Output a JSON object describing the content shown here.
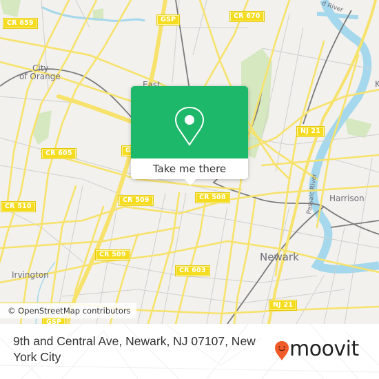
{
  "map": {
    "colors": {
      "background": "#f2f1ed",
      "major_road": "#f7e26b",
      "minor_road": "#c8c8c8",
      "water": "#a5d8ec",
      "park": "#d6e8c0",
      "rail": "#7a7a7a",
      "shield": "#f5dc1f"
    },
    "road_shields": [
      {
        "label": "CR 659"
      },
      {
        "label": "GSP"
      },
      {
        "label": "CR 670"
      },
      {
        "label": "CR 605"
      },
      {
        "label": "GSP"
      },
      {
        "label": "NJ 21"
      },
      {
        "label": "CR 510"
      },
      {
        "label": "CR 509"
      },
      {
        "label": "CR 508"
      },
      {
        "label": "CR 509"
      },
      {
        "label": "CR 603"
      },
      {
        "label": "NJ 21"
      },
      {
        "label": "GSP"
      }
    ],
    "place_labels": [
      {
        "label": "City"
      },
      {
        "label": "of Orange"
      },
      {
        "label": "East"
      },
      {
        "label": "Harrison"
      },
      {
        "label": "Newark"
      },
      {
        "label": "Irvington"
      },
      {
        "label": "K"
      }
    ],
    "water_labels": [
      {
        "label": "Passaic River"
      },
      {
        "label": "d River"
      }
    ],
    "attribution": "© OpenStreetMap contributors"
  },
  "popup": {
    "icon": "location-pin-icon",
    "button_label": "Take me there",
    "color": "#1db86a"
  },
  "footer": {
    "address": "9th and Central Ave, Newark, NJ 07107, New York City",
    "brand_name": "moovit",
    "brand_icon": "moovit-smiley-pin-icon",
    "brand_color": "#f15a29"
  }
}
